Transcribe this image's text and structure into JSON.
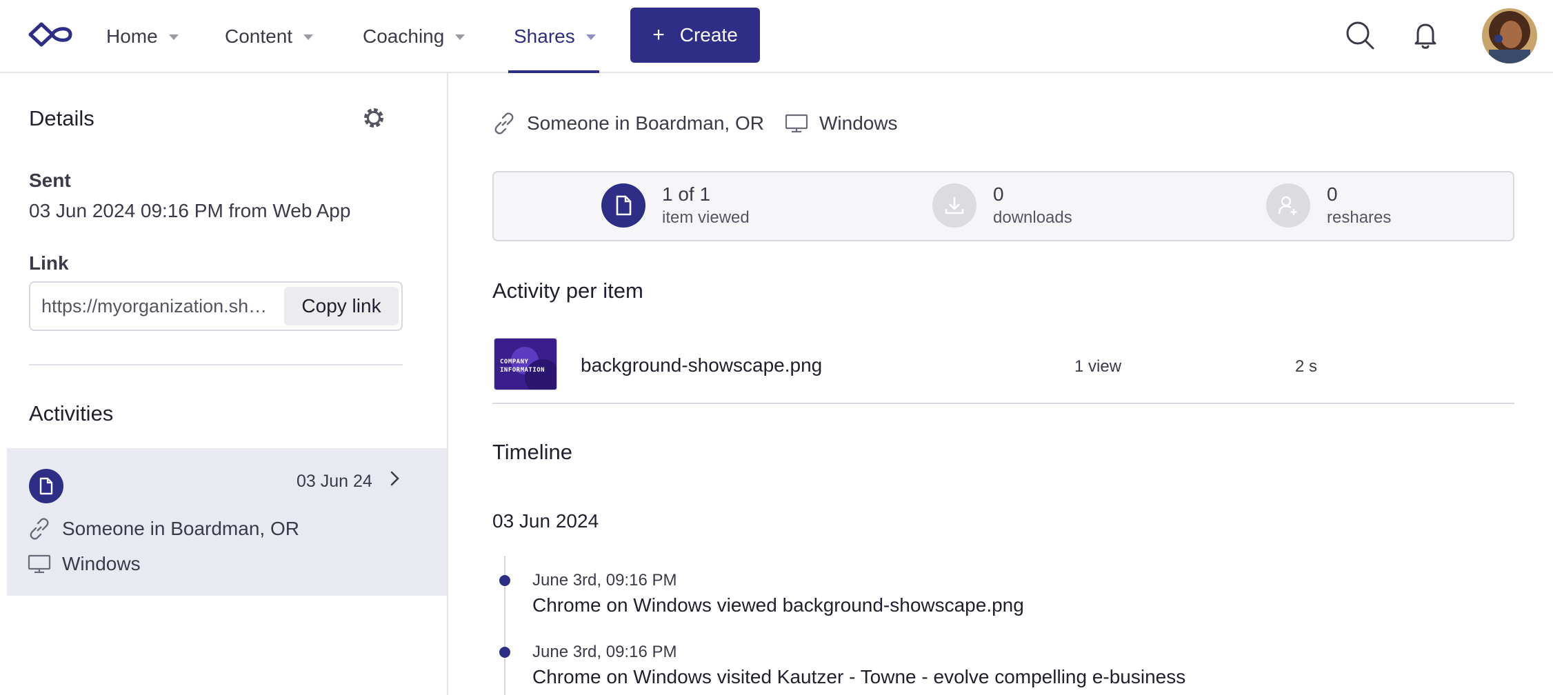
{
  "nav": {
    "items": [
      {
        "label": "Home"
      },
      {
        "label": "Content"
      },
      {
        "label": "Coaching"
      },
      {
        "label": "Shares"
      }
    ],
    "active": "Shares",
    "create_label": "Create",
    "accent": "#2e2e86"
  },
  "details": {
    "title": "Details",
    "sent_label": "Sent",
    "sent_value": "03 Jun 2024 09:16 PM from Web App",
    "link_label": "Link",
    "link_value": "https://myorganization.showpad.com/share/...",
    "copy_label": "Copy link"
  },
  "activities": {
    "title": "Activities",
    "card": {
      "date": "03 Jun 24",
      "location": "Someone in Boardman, OR",
      "device": "Windows"
    }
  },
  "session": {
    "location": "Someone in Boardman, OR",
    "device": "Windows"
  },
  "stats": [
    {
      "value": "1 of 1",
      "label": "item viewed",
      "icon": "document-icon"
    },
    {
      "value": "0",
      "label": "downloads",
      "icon": "download-icon"
    },
    {
      "value": "0",
      "label": "reshares",
      "icon": "add-user-icon"
    }
  ],
  "activity_per_item": {
    "title": "Activity per item",
    "items": [
      {
        "thumb_text": "COMPANY INFORMATION",
        "name": "background-showscape.png",
        "views": "1 view",
        "time": "2 s"
      }
    ]
  },
  "timeline": {
    "title": "Timeline",
    "date": "03 Jun 2024",
    "events": [
      {
        "time": "June 3rd, 09:16 PM",
        "text": "Chrome on Windows viewed background-showscape.png"
      },
      {
        "time": "June 3rd, 09:16 PM",
        "text": "Chrome on Windows visited Kautzer - Towne - evolve compelling e-business"
      }
    ]
  }
}
